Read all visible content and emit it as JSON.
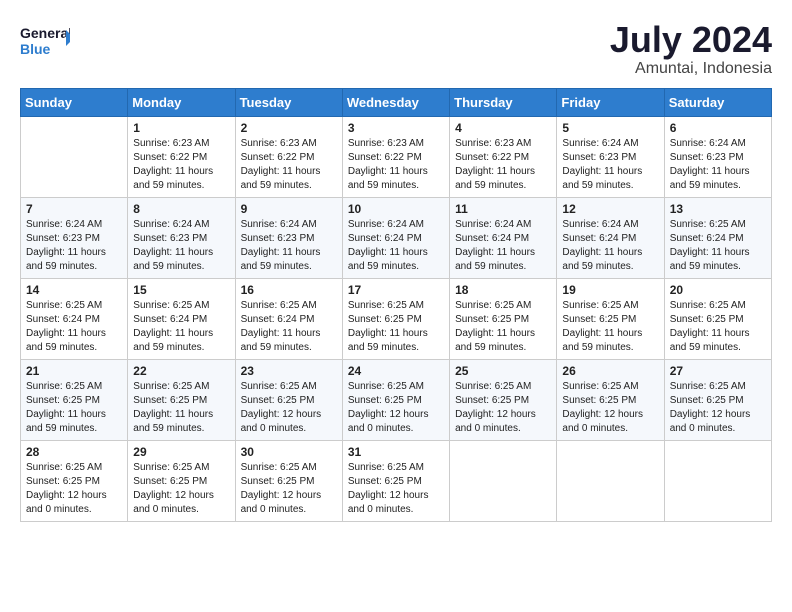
{
  "header": {
    "logo_line1": "General",
    "logo_line2": "Blue",
    "month_year": "July 2024",
    "location": "Amuntai, Indonesia"
  },
  "weekdays": [
    "Sunday",
    "Monday",
    "Tuesday",
    "Wednesday",
    "Thursday",
    "Friday",
    "Saturday"
  ],
  "weeks": [
    [
      {
        "day": "",
        "info": ""
      },
      {
        "day": "1",
        "info": "Sunrise: 6:23 AM\nSunset: 6:22 PM\nDaylight: 11 hours\nand 59 minutes."
      },
      {
        "day": "2",
        "info": "Sunrise: 6:23 AM\nSunset: 6:22 PM\nDaylight: 11 hours\nand 59 minutes."
      },
      {
        "day": "3",
        "info": "Sunrise: 6:23 AM\nSunset: 6:22 PM\nDaylight: 11 hours\nand 59 minutes."
      },
      {
        "day": "4",
        "info": "Sunrise: 6:23 AM\nSunset: 6:22 PM\nDaylight: 11 hours\nand 59 minutes."
      },
      {
        "day": "5",
        "info": "Sunrise: 6:24 AM\nSunset: 6:23 PM\nDaylight: 11 hours\nand 59 minutes."
      },
      {
        "day": "6",
        "info": "Sunrise: 6:24 AM\nSunset: 6:23 PM\nDaylight: 11 hours\nand 59 minutes."
      }
    ],
    [
      {
        "day": "7",
        "info": "Sunrise: 6:24 AM\nSunset: 6:23 PM\nDaylight: 11 hours\nand 59 minutes."
      },
      {
        "day": "8",
        "info": "Sunrise: 6:24 AM\nSunset: 6:23 PM\nDaylight: 11 hours\nand 59 minutes."
      },
      {
        "day": "9",
        "info": "Sunrise: 6:24 AM\nSunset: 6:23 PM\nDaylight: 11 hours\nand 59 minutes."
      },
      {
        "day": "10",
        "info": "Sunrise: 6:24 AM\nSunset: 6:24 PM\nDaylight: 11 hours\nand 59 minutes."
      },
      {
        "day": "11",
        "info": "Sunrise: 6:24 AM\nSunset: 6:24 PM\nDaylight: 11 hours\nand 59 minutes."
      },
      {
        "day": "12",
        "info": "Sunrise: 6:24 AM\nSunset: 6:24 PM\nDaylight: 11 hours\nand 59 minutes."
      },
      {
        "day": "13",
        "info": "Sunrise: 6:25 AM\nSunset: 6:24 PM\nDaylight: 11 hours\nand 59 minutes."
      }
    ],
    [
      {
        "day": "14",
        "info": "Sunrise: 6:25 AM\nSunset: 6:24 PM\nDaylight: 11 hours\nand 59 minutes."
      },
      {
        "day": "15",
        "info": "Sunrise: 6:25 AM\nSunset: 6:24 PM\nDaylight: 11 hours\nand 59 minutes."
      },
      {
        "day": "16",
        "info": "Sunrise: 6:25 AM\nSunset: 6:24 PM\nDaylight: 11 hours\nand 59 minutes."
      },
      {
        "day": "17",
        "info": "Sunrise: 6:25 AM\nSunset: 6:25 PM\nDaylight: 11 hours\nand 59 minutes."
      },
      {
        "day": "18",
        "info": "Sunrise: 6:25 AM\nSunset: 6:25 PM\nDaylight: 11 hours\nand 59 minutes."
      },
      {
        "day": "19",
        "info": "Sunrise: 6:25 AM\nSunset: 6:25 PM\nDaylight: 11 hours\nand 59 minutes."
      },
      {
        "day": "20",
        "info": "Sunrise: 6:25 AM\nSunset: 6:25 PM\nDaylight: 11 hours\nand 59 minutes."
      }
    ],
    [
      {
        "day": "21",
        "info": "Sunrise: 6:25 AM\nSunset: 6:25 PM\nDaylight: 11 hours\nand 59 minutes."
      },
      {
        "day": "22",
        "info": "Sunrise: 6:25 AM\nSunset: 6:25 PM\nDaylight: 11 hours\nand 59 minutes."
      },
      {
        "day": "23",
        "info": "Sunrise: 6:25 AM\nSunset: 6:25 PM\nDaylight: 12 hours\nand 0 minutes."
      },
      {
        "day": "24",
        "info": "Sunrise: 6:25 AM\nSunset: 6:25 PM\nDaylight: 12 hours\nand 0 minutes."
      },
      {
        "day": "25",
        "info": "Sunrise: 6:25 AM\nSunset: 6:25 PM\nDaylight: 12 hours\nand 0 minutes."
      },
      {
        "day": "26",
        "info": "Sunrise: 6:25 AM\nSunset: 6:25 PM\nDaylight: 12 hours\nand 0 minutes."
      },
      {
        "day": "27",
        "info": "Sunrise: 6:25 AM\nSunset: 6:25 PM\nDaylight: 12 hours\nand 0 minutes."
      }
    ],
    [
      {
        "day": "28",
        "info": "Sunrise: 6:25 AM\nSunset: 6:25 PM\nDaylight: 12 hours\nand 0 minutes."
      },
      {
        "day": "29",
        "info": "Sunrise: 6:25 AM\nSunset: 6:25 PM\nDaylight: 12 hours\nand 0 minutes."
      },
      {
        "day": "30",
        "info": "Sunrise: 6:25 AM\nSunset: 6:25 PM\nDaylight: 12 hours\nand 0 minutes."
      },
      {
        "day": "31",
        "info": "Sunrise: 6:25 AM\nSunset: 6:25 PM\nDaylight: 12 hours\nand 0 minutes."
      },
      {
        "day": "",
        "info": ""
      },
      {
        "day": "",
        "info": ""
      },
      {
        "day": "",
        "info": ""
      }
    ]
  ]
}
